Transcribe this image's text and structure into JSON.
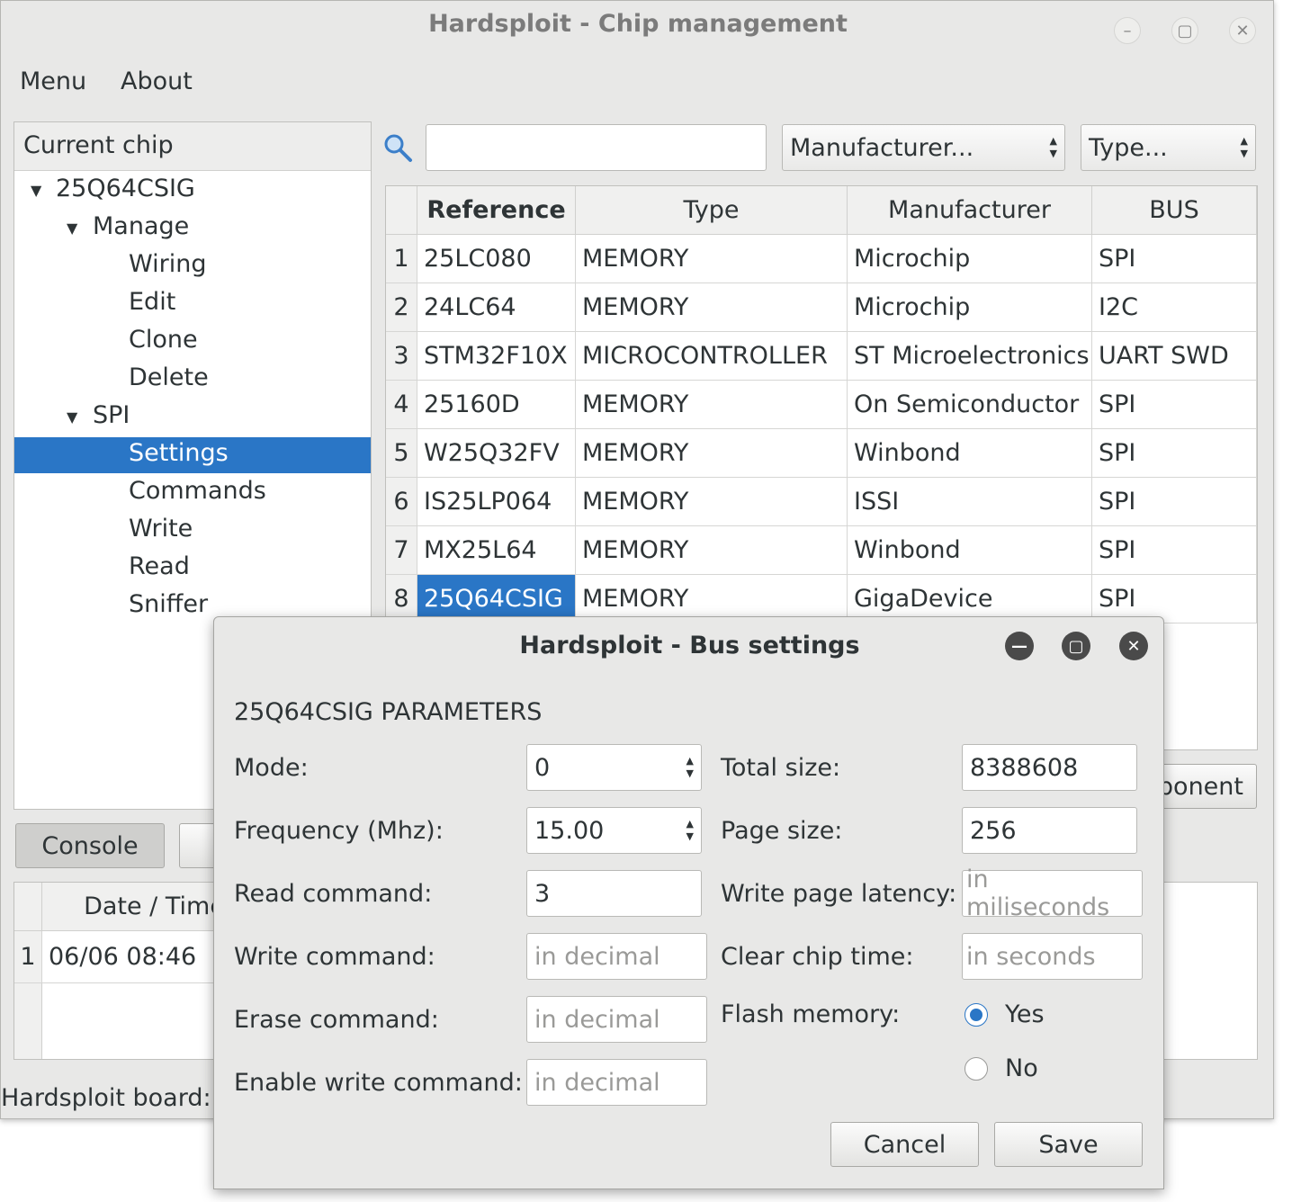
{
  "window": {
    "title": "Hardsploit - Chip management",
    "minimize_icon": "minimize-icon",
    "maximize_icon": "maximize-icon",
    "close_icon": "close-icon"
  },
  "menu": [
    "Menu",
    "About"
  ],
  "tree": {
    "header": "Current chip",
    "chip": "25Q64CSIG",
    "groups": [
      {
        "label": "Manage",
        "items": [
          "Wiring",
          "Edit",
          "Clone",
          "Delete"
        ]
      },
      {
        "label": "SPI",
        "items": [
          "Settings",
          "Commands",
          "Write",
          "Read",
          "Sniffer"
        ]
      }
    ],
    "selected": "Settings"
  },
  "filters": {
    "search_value": "",
    "manufacturer": "Manufacturer...",
    "type": "Type..."
  },
  "chip_table": {
    "columns": [
      "Reference",
      "Type",
      "Manufacturer",
      "BUS"
    ],
    "rows": [
      {
        "n": "1",
        "ref": "25LC080",
        "type": "MEMORY",
        "man": "Microchip",
        "bus": "SPI"
      },
      {
        "n": "2",
        "ref": "24LC64",
        "type": "MEMORY",
        "man": "Microchip",
        "bus": "I2C"
      },
      {
        "n": "3",
        "ref": "STM32F10X",
        "type": "MICROCONTROLLER",
        "man": "ST Microelectronics",
        "bus": "UART SWD"
      },
      {
        "n": "4",
        "ref": "25160D",
        "type": "MEMORY",
        "man": "On Semiconductor",
        "bus": "SPI"
      },
      {
        "n": "5",
        "ref": "W25Q32FV",
        "type": "MEMORY",
        "man": "Winbond",
        "bus": "SPI"
      },
      {
        "n": "6",
        "ref": "IS25LP064",
        "type": "MEMORY",
        "man": "ISSI",
        "bus": "SPI"
      },
      {
        "n": "7",
        "ref": "MX25L64",
        "type": "MEMORY",
        "man": "Winbond",
        "bus": "SPI"
      },
      {
        "n": "8",
        "ref": "25Q64CSIG",
        "type": "MEMORY",
        "man": "GigaDevice",
        "bus": "SPI"
      }
    ],
    "selected_row": "8"
  },
  "component_button_partial": "ponent",
  "bottom": {
    "console_label": "Console",
    "log_columns": [
      "Date / Time"
    ],
    "log_rows": [
      {
        "n": "1",
        "datetime": "06/06 08:46"
      }
    ],
    "status_partial": "Hardsploit board: "
  },
  "dialog": {
    "title": "Hardsploit - Bus settings",
    "heading": "25Q64CSIG  PARAMETERS",
    "mode_label": "Mode:",
    "mode_value": "0",
    "frequency_label": "Frequency (Mhz):",
    "frequency_value": "15.00",
    "read_cmd_label": "Read command:",
    "read_cmd_value": "3",
    "write_cmd_label": "Write command:",
    "write_cmd_placeholder": "in decimal",
    "erase_cmd_label": "Erase command:",
    "erase_cmd_placeholder": "in decimal",
    "enable_write_label": "Enable write command:",
    "enable_write_placeholder": "in decimal",
    "total_size_label": "Total size:",
    "total_size_value": "8388608",
    "page_size_label": "Page size:",
    "page_size_value": "256",
    "write_latency_label": "Write page latency:",
    "write_latency_placeholder": "in miliseconds",
    "clear_time_label": "Clear chip time:",
    "clear_time_placeholder": "in seconds",
    "flash_label": "Flash memory:",
    "flash_yes": "Yes",
    "flash_no": "No",
    "flash_selected": "Yes",
    "cancel_label": "Cancel",
    "save_label": "Save"
  },
  "colors": {
    "selection": "#2a76c6",
    "window_bg": "#e8e8e7"
  }
}
